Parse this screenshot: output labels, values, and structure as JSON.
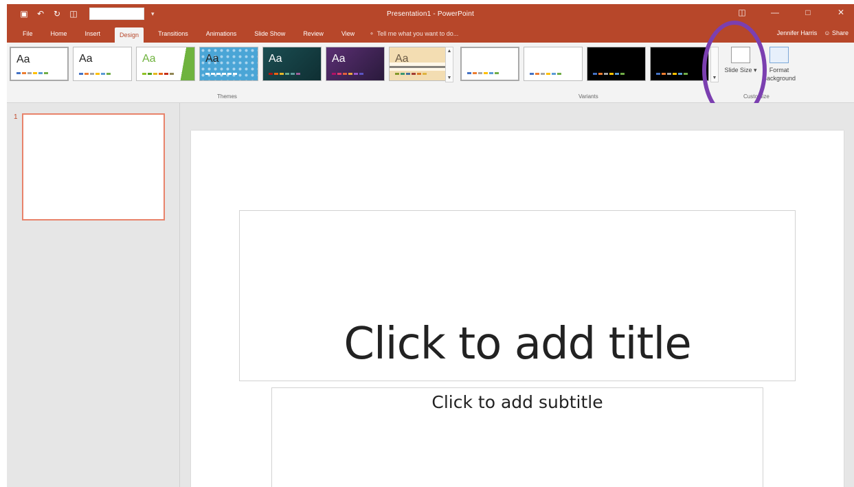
{
  "app": {
    "window_title": "Presentation1 - PowerPoint",
    "user": "Jennifer Harris",
    "share_label": "Share"
  },
  "colors": {
    "accent": "#b7472a",
    "ribbon_bg": "#f3f3f3",
    "highlight_ring": "#7b3fb0",
    "thumb_border": "#e8826a"
  },
  "qat": {
    "icons": [
      "save-icon",
      "undo-icon",
      "redo-icon",
      "customize-icon"
    ]
  },
  "tabs": [
    {
      "label": "File",
      "active": false
    },
    {
      "label": "Home",
      "active": false
    },
    {
      "label": "Insert",
      "active": false
    },
    {
      "label": "Design",
      "active": true
    },
    {
      "label": "Transitions",
      "active": false
    },
    {
      "label": "Animations",
      "active": false
    },
    {
      "label": "Slide Show",
      "active": false
    },
    {
      "label": "Review",
      "active": false
    },
    {
      "label": "View",
      "active": false
    }
  ],
  "tell_me": "Tell me what you want to do...",
  "ribbon": {
    "themes_label": "Themes",
    "variants_label": "Variants",
    "customize_label": "Customize",
    "theme_glyph": "Aa",
    "slide_size_label": "Slide Size",
    "format_background_label": "Format Background"
  },
  "thumbnails": {
    "slide_number": "1"
  },
  "slide": {
    "title_placeholder": "Click to add title",
    "subtitle_placeholder": "Click to add subtitle"
  }
}
